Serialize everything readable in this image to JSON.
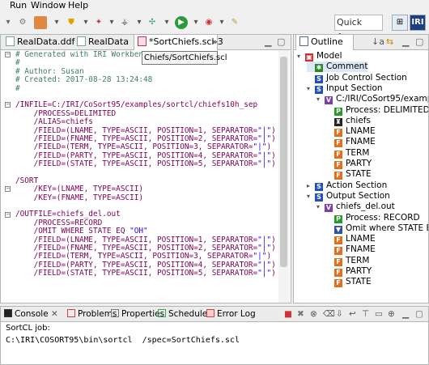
{
  "menu": [
    "Run",
    "Window",
    "Help"
  ],
  "toolbar": {
    "quick_access_placeholder": "Quick Access",
    "perspective_label": "IRI"
  },
  "editor": {
    "tabs": [
      {
        "label": "RealData.ddf"
      },
      {
        "label": "RealData"
      },
      {
        "label": "*SortChiefs.scl"
      },
      {
        "label": "»3"
      }
    ],
    "tooltip": "Chiefs/SortChiefs.scl",
    "lines": [
      "# Generated with IRI Workbench",
      "#",
      "# Author: Susan",
      "# Created: 2017-08-28 13:24:48",
      "#",
      "",
      "/INFILE=C:/IRI/CoSort95/examples/sortcl/chiefs10h_sep",
      "    /PROCESS=DELIMITED",
      "    /ALIAS=chiefs",
      "    /FIELD=(LNAME, TYPE=ASCII, POSITION=1, SEPARATOR=\"|\")",
      "    /FIELD=(FNAME, TYPE=ASCII, POSITION=2, SEPARATOR=\"|\")",
      "    /FIELD=(TERM, TYPE=ASCII, POSITION=3, SEPARATOR=\"|\")",
      "    /FIELD=(PARTY, TYPE=ASCII, POSITION=4, SEPARATOR=\"|\")",
      "    /FIELD=(STATE, TYPE=ASCII, POSITION=5, SEPARATOR=\"|\")",
      "",
      "/SORT",
      "    /KEY=(LNAME, TYPE=ASCII)",
      "    /KEY=(FNAME, TYPE=ASCII)",
      "",
      "/OUTFILE=chiefs_del.out",
      "    /PROCESS=RECORD",
      "    /OMIT WHERE STATE EQ \"OH\"",
      "    /FIELD=(LNAME, TYPE=ASCII, POSITION=1, SEPARATOR=\"|\")",
      "    /FIELD=(FNAME, TYPE=ASCII, POSITION=2, SEPARATOR=\"|\")",
      "    /FIELD=(TERM, TYPE=ASCII, POSITION=3, SEPARATOR=\"|\")",
      "    /FIELD=(PARTY, TYPE=ASCII, POSITION=4, SEPARATOR=\"|\")",
      "    /FIELD=(STATE, TYPE=ASCII, POSITION=5, SEPARATOR=\"|\")"
    ]
  },
  "outline": {
    "tab_label": "Outline",
    "items": [
      {
        "label": "Model",
        "icon": "model-icon",
        "color": "#d03030"
      },
      {
        "label": "Comment",
        "icon": "comment-icon",
        "color": "#2a8a2a"
      },
      {
        "label": "Job Control Section",
        "icon": "section-icon",
        "color": "#2050c0"
      },
      {
        "label": "Input Section",
        "icon": "section-icon",
        "color": "#2050c0"
      },
      {
        "label": "C:/IRI/CoSort95/examples/s",
        "icon": "file-icon",
        "color": "#7a40b0"
      },
      {
        "label": "Process: DELIMITED",
        "icon": "process-icon",
        "color": "#2a9a2a"
      },
      {
        "label": "chiefs",
        "icon": "alias-icon",
        "color": "#222222"
      },
      {
        "label": "LNAME",
        "icon": "field-icon",
        "color": "#e07020"
      },
      {
        "label": "FNAME",
        "icon": "field-icon",
        "color": "#e07020"
      },
      {
        "label": "TERM",
        "icon": "field-icon",
        "color": "#e07020"
      },
      {
        "label": "PARTY",
        "icon": "field-icon",
        "color": "#e07020"
      },
      {
        "label": "STATE",
        "icon": "field-icon",
        "color": "#e07020"
      },
      {
        "label": "Action Section",
        "icon": "section-icon",
        "color": "#2050c0"
      },
      {
        "label": "Output Section",
        "icon": "section-icon",
        "color": "#2050c0"
      },
      {
        "label": "chiefs_del.out",
        "icon": "file-icon",
        "color": "#7a40b0"
      },
      {
        "label": "Process: RECORD",
        "icon": "process-icon",
        "color": "#2a9a2a"
      },
      {
        "label": "Omit where STATE EQ \"",
        "icon": "omit-icon",
        "color": "#3050a0"
      },
      {
        "label": "LNAME",
        "icon": "field-icon",
        "color": "#e07020"
      },
      {
        "label": "FNAME",
        "icon": "field-icon",
        "color": "#e07020"
      },
      {
        "label": "TERM",
        "icon": "field-icon",
        "color": "#e07020"
      },
      {
        "label": "PARTY",
        "icon": "field-icon",
        "color": "#e07020"
      },
      {
        "label": "STATE",
        "icon": "field-icon",
        "color": "#e07020"
      }
    ]
  },
  "bottom": {
    "tabs": [
      {
        "label": "Console"
      },
      {
        "label": "Problems"
      },
      {
        "label": "Properties"
      },
      {
        "label": "Scheduler"
      },
      {
        "label": "Error Log"
      }
    ],
    "console_title": "SortCL job:",
    "console_line": "C:\\IRI\\COSORT95\\bin\\sortcl  /spec=SortChiefs.scl"
  },
  "colors": {
    "comment": "#3f7f5f",
    "keyword": "#7f0055",
    "string": "#2a00ff"
  }
}
